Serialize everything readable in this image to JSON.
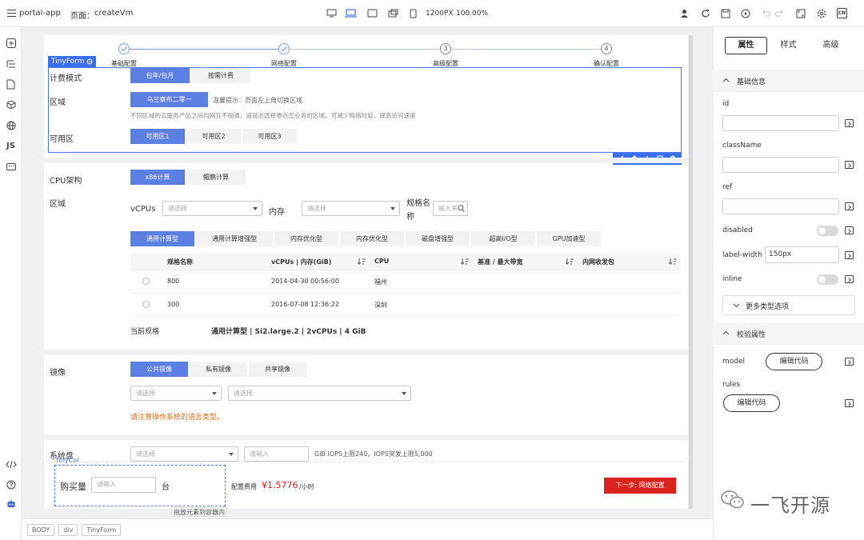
{
  "topbar": {
    "app_name": "portal-app",
    "page_label": "页面：",
    "page_name": "createVm",
    "viewport": "1200PX",
    "zoom": "100.00%",
    "lang_badge": "CN"
  },
  "left_nav": {
    "js_label": "JS"
  },
  "steps": [
    {
      "num": "",
      "label": "基础配置",
      "state": "done"
    },
    {
      "num": "",
      "label": "网络配置",
      "state": "done"
    },
    {
      "num": "3",
      "label": "高级配置",
      "state": "todo"
    },
    {
      "num": "4",
      "label": "确认配置",
      "state": "todo"
    }
  ],
  "tinyform_tag": "TinyForm",
  "billing": {
    "label": "计费模式",
    "options": [
      "包年/包月",
      "按需计费"
    ],
    "selected": 0
  },
  "region": {
    "label": "区域",
    "button": "乌兰察布二零一",
    "tip": "温馨提示：页面左上角切换区域",
    "note": "不同区域的云服务产品之间内网互不相通；请就近选择靠近您业务的区域，可减少网络时延，提高访问速度"
  },
  "zone": {
    "label": "可用区",
    "options": [
      "可用区1",
      "可用区2",
      "可用区3"
    ],
    "selected": 0
  },
  "cpu": {
    "label": "CPU架构",
    "options": [
      "x86计算",
      "鲲鹏计算"
    ],
    "selected": 0
  },
  "spec": {
    "region_label": "区域",
    "vcpus_label": "vCPUs",
    "vcpus_placeholder": "请选择",
    "mem_label": "内存",
    "mem_placeholder": "请选择",
    "name_label": "规格名称",
    "name_placeholder": "输入关",
    "tabs": [
      "通用计算型",
      "通用计算增强型",
      "内存优化型",
      "内存优化型",
      "磁盘增强型",
      "超高I/O型",
      "GPU加速型"
    ],
    "selected_tab": 0,
    "columns": [
      "规格名称",
      "vCPUs | 内存(GiB)",
      "CPU",
      "基准 / 最大带宽",
      "内网收发包"
    ],
    "rows": [
      {
        "name": "800",
        "vcpu_mem": "2014-04-30 00:56:00",
        "cpu": "福州"
      },
      {
        "name": "300",
        "vcpu_mem": "2016-07-08 12:36:22",
        "cpu": "深圳"
      }
    ],
    "current_label": "当前规格",
    "current_value": "通用计算型 | Si2.large.2 | 2vCPUs | 4 GiB"
  },
  "image": {
    "label": "镜像",
    "options": [
      "公共镜像",
      "私有镜像",
      "共享镜像"
    ],
    "selected": 0,
    "select1_placeholder": "请选择",
    "select2_placeholder": "请选择",
    "warning": "请注意操作系统的语言类型。"
  },
  "disk": {
    "label": "系统盘",
    "select_placeholder": "请选择",
    "input_placeholder": "请输入",
    "info": "GiB IOPS上限240，IOPS突发上限5,000"
  },
  "footer": {
    "tinycol_tag": "TinyCol",
    "qty_label": "购买量",
    "qty_placeholder": "请输入",
    "qty_unit": "台",
    "fee_label": "配置费用",
    "fee_value": "¥1.5776",
    "fee_unit": "/小时",
    "next_button": "下一步: 网络配置",
    "drop_hint": "拖放元素到容器内"
  },
  "breadcrumb": [
    "BODY",
    "div",
    "TinyForm"
  ],
  "right_panel": {
    "tabs": [
      "属性",
      "样式",
      "高级"
    ],
    "selected_tab": 0,
    "basic_section": "基础信息",
    "fields": {
      "id_label": "id",
      "classname_label": "className",
      "ref_label": "ref",
      "disabled_label": "disabled",
      "label_width_label": "label-width",
      "label_width_value": "150px",
      "inline_label": "inline"
    },
    "more_types": "更多类型选项",
    "validate_section": "校验属性",
    "model_label": "model",
    "model_button": "编辑代码",
    "rules_label": "rules",
    "rules_button": "编辑代码"
  },
  "watermark": "一飞开源",
  "colors": {
    "primary": "#5b7fe2",
    "select_border": "#4a7cf0",
    "danger": "#d9231c",
    "warning": "#e36c1a"
  }
}
